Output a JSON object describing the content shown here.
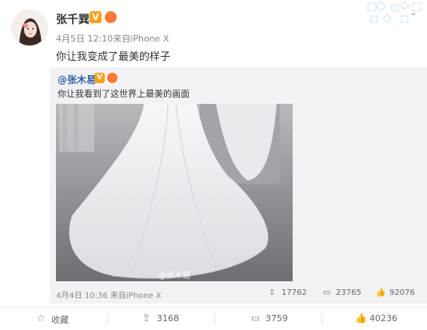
{
  "post": {
    "username": "张千巽",
    "meta": "4月5日 12:10来自iPhone X",
    "text": "你让我变成了最美的样子"
  },
  "repost": {
    "username": "@张木易",
    "text": "你让我看到了这世界上最美的画面",
    "watermark": "@张木易",
    "meta": "4月4日 10:36 来自iPhone X",
    "stats": {
      "reposts": "17762",
      "comments": "23765",
      "likes": "92076"
    }
  },
  "footer": {
    "favorite": "收藏",
    "reposts": "3168",
    "comments": "3759",
    "likes": "40236"
  },
  "colors": {
    "link": "#2f5fa6",
    "badge_v": "#f7a21b",
    "repost_bg": "#f2f2f5"
  },
  "icons": [
    "verified-icon",
    "emoji-badge-icon",
    "chevron-down-icon",
    "share-icon",
    "comment-icon",
    "like-icon",
    "star-icon"
  ]
}
